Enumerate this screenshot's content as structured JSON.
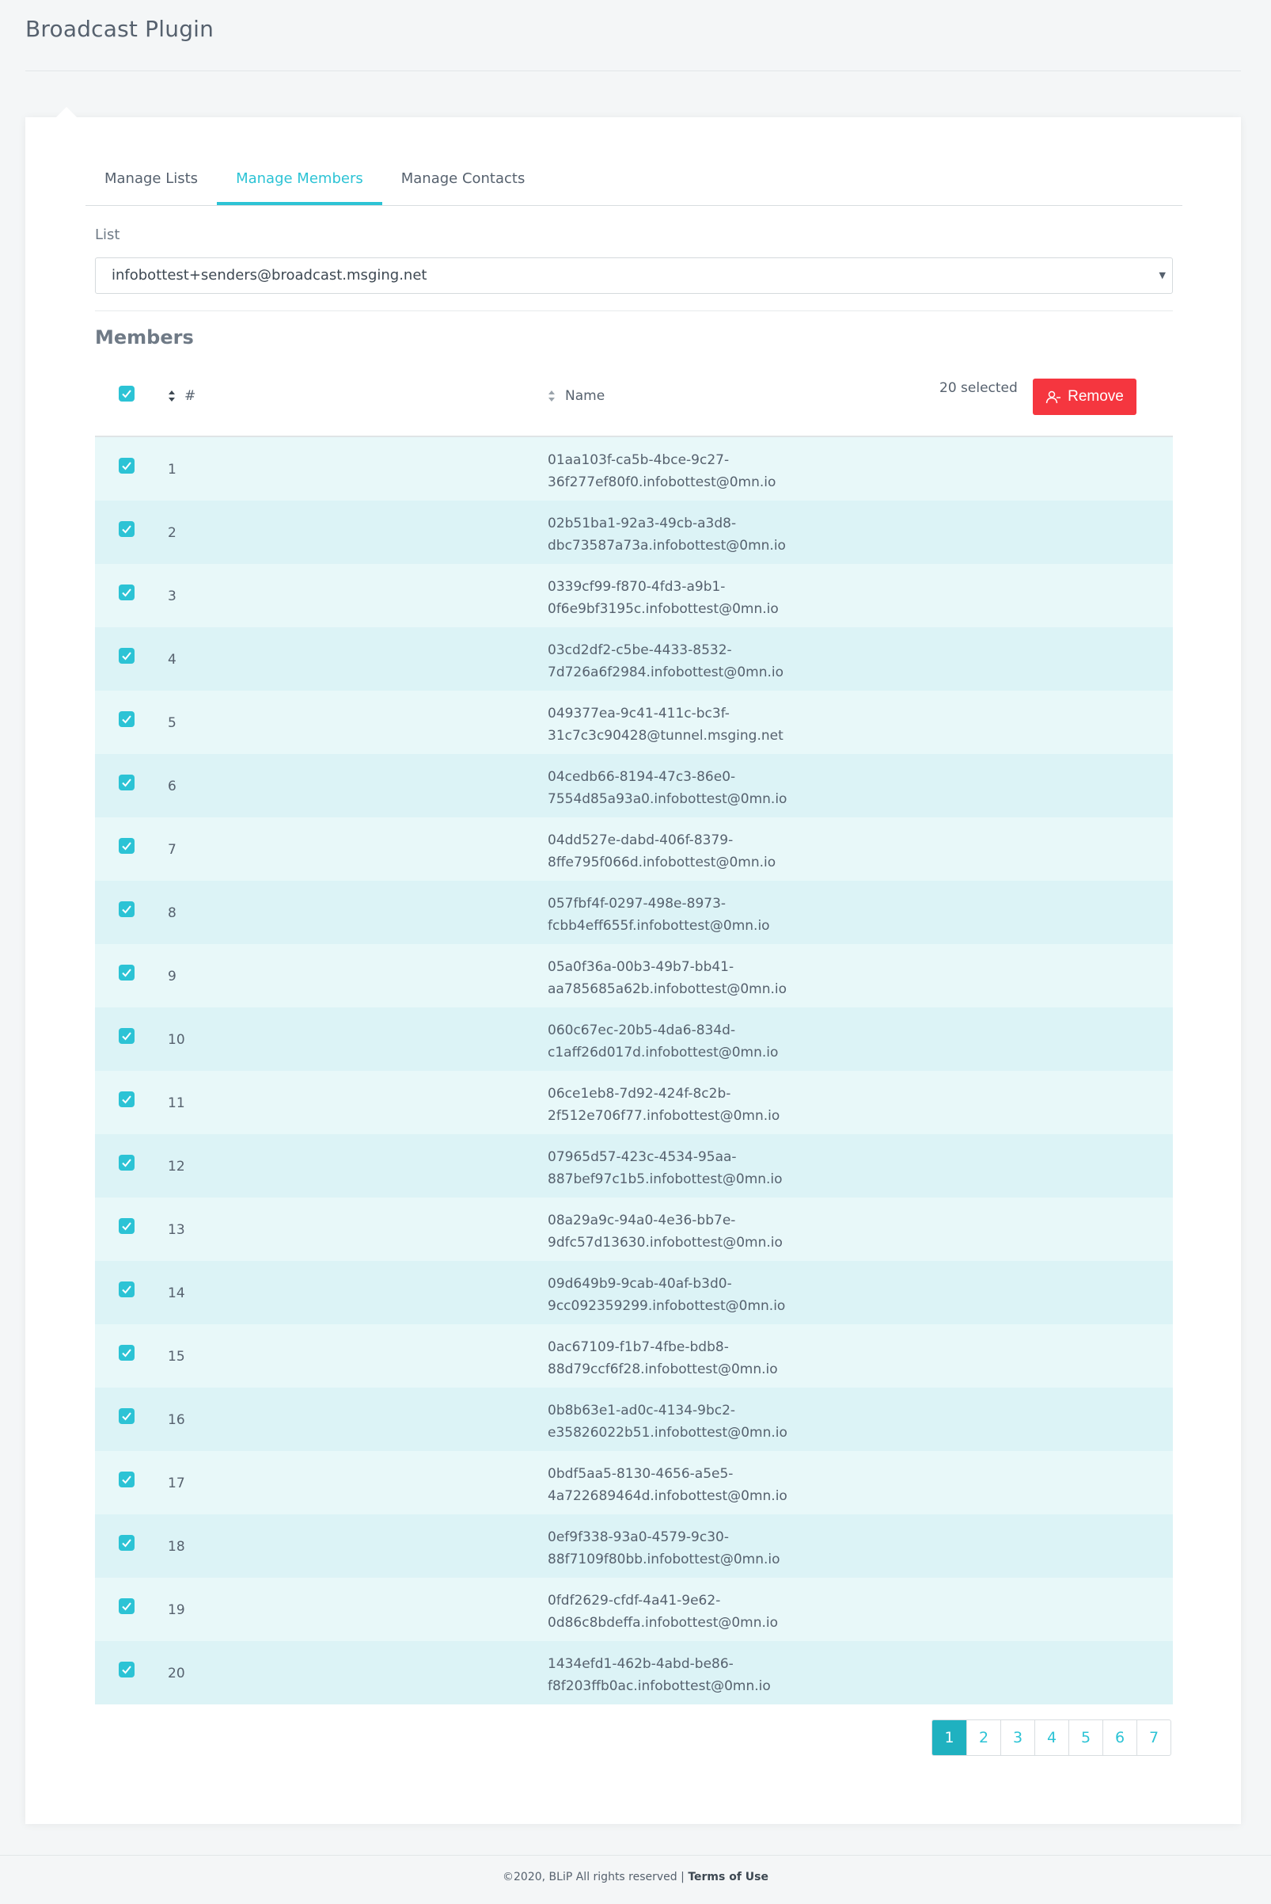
{
  "app": {
    "title": "Broadcast Plugin"
  },
  "tabs": [
    {
      "label": "Manage Lists"
    },
    {
      "label": "Manage Members"
    },
    {
      "label": "Manage Contacts"
    }
  ],
  "list": {
    "label": "List",
    "selected": "infobottest+senders@broadcast.msging.net"
  },
  "members": {
    "title": "Members",
    "columns": {
      "number": "#",
      "name": "Name"
    },
    "selected_text": "20 selected",
    "remove_label": "Remove",
    "rows": [
      {
        "num": "1",
        "line1": "01aa103f-ca5b-4bce-9c27-",
        "line2": "36f277ef80f0.infobottest@0mn.io"
      },
      {
        "num": "2",
        "line1": "02b51ba1-92a3-49cb-a3d8-",
        "line2": "dbc73587a73a.infobottest@0mn.io"
      },
      {
        "num": "3",
        "line1": "0339cf99-f870-4fd3-a9b1-",
        "line2": "0f6e9bf3195c.infobottest@0mn.io"
      },
      {
        "num": "4",
        "line1": "03cd2df2-c5be-4433-8532-",
        "line2": "7d726a6f2984.infobottest@0mn.io"
      },
      {
        "num": "5",
        "line1": "049377ea-9c41-411c-bc3f-",
        "line2": "31c7c3c90428@tunnel.msging.net"
      },
      {
        "num": "6",
        "line1": "04cedb66-8194-47c3-86e0-",
        "line2": "7554d85a93a0.infobottest@0mn.io"
      },
      {
        "num": "7",
        "line1": "04dd527e-dabd-406f-8379-",
        "line2": "8ffe795f066d.infobottest@0mn.io"
      },
      {
        "num": "8",
        "line1": "057fbf4f-0297-498e-8973-",
        "line2": "fcbb4eff655f.infobottest@0mn.io"
      },
      {
        "num": "9",
        "line1": "05a0f36a-00b3-49b7-bb41-",
        "line2": "aa785685a62b.infobottest@0mn.io"
      },
      {
        "num": "10",
        "line1": "060c67ec-20b5-4da6-834d-",
        "line2": "c1aff26d017d.infobottest@0mn.io"
      },
      {
        "num": "11",
        "line1": "06ce1eb8-7d92-424f-8c2b-",
        "line2": "2f512e706f77.infobottest@0mn.io"
      },
      {
        "num": "12",
        "line1": "07965d57-423c-4534-95aa-",
        "line2": "887bef97c1b5.infobottest@0mn.io"
      },
      {
        "num": "13",
        "line1": "08a29a9c-94a0-4e36-bb7e-",
        "line2": "9dfc57d13630.infobottest@0mn.io"
      },
      {
        "num": "14",
        "line1": "09d649b9-9cab-40af-b3d0-",
        "line2": "9cc092359299.infobottest@0mn.io"
      },
      {
        "num": "15",
        "line1": "0ac67109-f1b7-4fbe-bdb8-",
        "line2": "88d79ccf6f28.infobottest@0mn.io"
      },
      {
        "num": "16",
        "line1": "0b8b63e1-ad0c-4134-9bc2-",
        "line2": "e35826022b51.infobottest@0mn.io"
      },
      {
        "num": "17",
        "line1": "0bdf5aa5-8130-4656-a5e5-",
        "line2": "4a722689464d.infobottest@0mn.io"
      },
      {
        "num": "18",
        "line1": "0ef9f338-93a0-4579-9c30-",
        "line2": "88f7109f80bb.infobottest@0mn.io"
      },
      {
        "num": "19",
        "line1": "0fdf2629-cfdf-4a41-9e62-",
        "line2": "0d86c8bdeffa.infobottest@0mn.io"
      },
      {
        "num": "20",
        "line1": "1434efd1-462b-4abd-be86-",
        "line2": "f8f203ffb0ac.infobottest@0mn.io"
      }
    ]
  },
  "pagination": {
    "pages": [
      "1",
      "2",
      "3",
      "4",
      "5",
      "6",
      "7"
    ],
    "current": "1"
  },
  "footer": {
    "copyright": "©2020, BLiP All rights reserved | ",
    "terms": "Terms of Use"
  },
  "colors": {
    "accent": "#2cc3d5",
    "danger": "#f5363f",
    "row_odd": "#e8f8f9",
    "row_even": "#dcf3f6"
  },
  "icons": {
    "checkbox": "check-icon",
    "sort": "sort-icon",
    "remove": "remove-user-icon",
    "select": "caret-down-icon"
  }
}
